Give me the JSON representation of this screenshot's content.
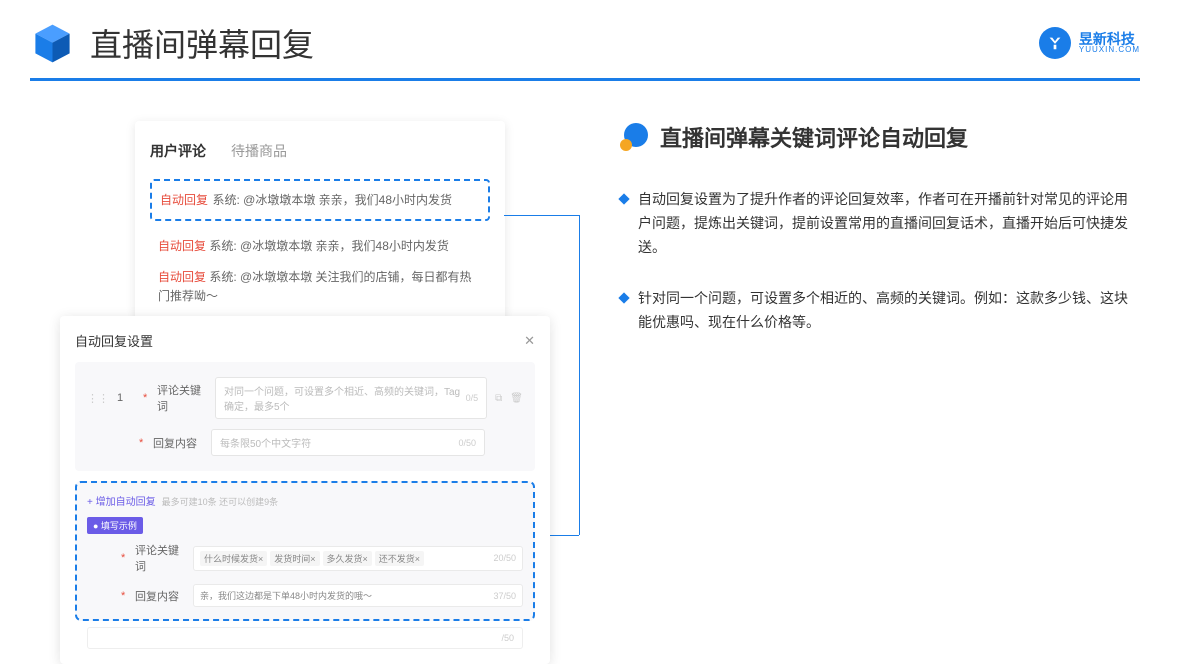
{
  "header": {
    "title": "直播间弹幕回复",
    "logo_cn": "昱新科技",
    "logo_en": "YUUXIN.COM",
    "logo_letter": "Y"
  },
  "comments": {
    "tab_active": "用户评论",
    "tab_inactive": "待播商品",
    "highlight_tag": "自动回复",
    "highlight_text": "系统: @冰墩墩本墩 亲亲，我们48小时内发货",
    "row2_tag": "自动回复",
    "row2_text": "系统: @冰墩墩本墩 亲亲，我们48小时内发货",
    "row3_tag": "自动回复",
    "row3_text": "系统: @冰墩墩本墩 关注我们的店铺，每日都有热门推荐呦～"
  },
  "settings": {
    "title": "自动回复设置",
    "close": "✕",
    "row_num": "1",
    "label_keyword": "评论关键词",
    "placeholder_keyword": "对同一个问题，可设置多个相近、高频的关键词，Tag确定，最多5个",
    "count_keyword": "0/5",
    "label_content": "回复内容",
    "placeholder_content": "每条限50个中文字符",
    "count_content": "0/50",
    "add_link": "+ 增加自动回复",
    "add_sub": "最多可建10条 还可以创建9条",
    "example_badge": "● 填写示例",
    "ex_label_kw": "评论关键词",
    "ex_tag1": "什么时候发货×",
    "ex_tag2": "发货时间×",
    "ex_tag3": "多久发货×",
    "ex_tag4": "还不发货×",
    "ex_count_kw": "20/50",
    "ex_label_cn": "回复内容",
    "ex_content": "亲，我们这边都是下单48小时内发货的哦～",
    "ex_count_cn": "37/50",
    "overflow_count": "/50"
  },
  "right": {
    "heading": "直播间弹幕关键词评论自动回复",
    "bullet1": "自动回复设置为了提升作者的评论回复效率，作者可在开播前针对常见的评论用户问题，提炼出关键词，提前设置常用的直播间回复话术，直播开始后可快捷发送。",
    "bullet2": "针对同一个问题，可设置多个相近的、高频的关键词。例如：这款多少钱、这块能优惠吗、现在什么价格等。"
  }
}
